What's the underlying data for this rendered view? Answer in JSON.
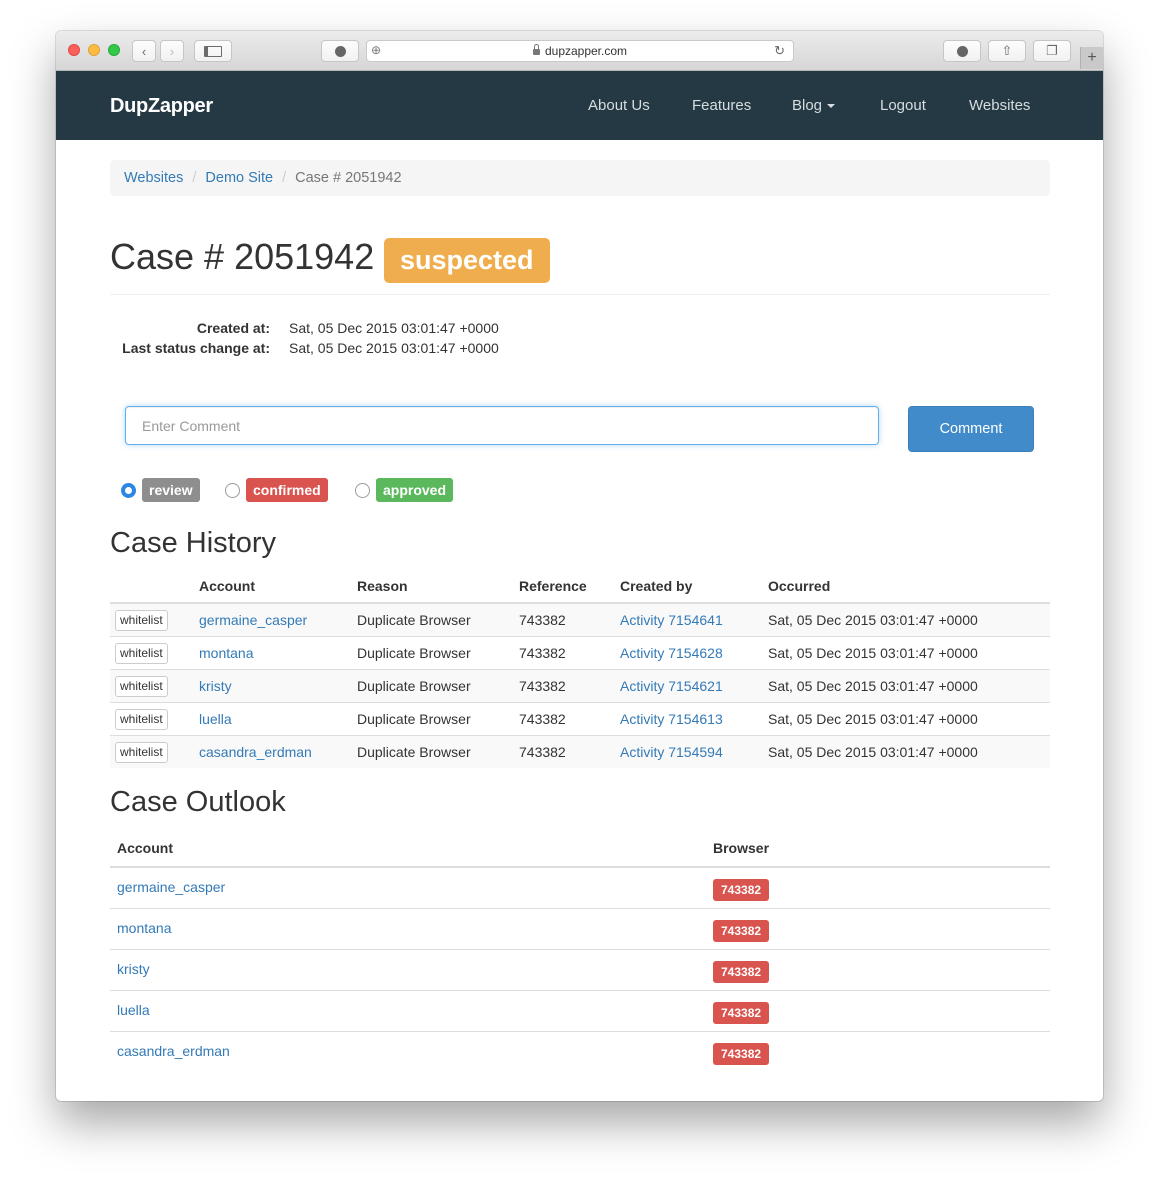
{
  "browser": {
    "url": "dupzapper.com"
  },
  "navbar": {
    "brand": "DupZapper",
    "links": [
      "About Us",
      "Features",
      "Blog",
      "Logout",
      "Websites"
    ]
  },
  "breadcrumb": {
    "items": [
      "Websites",
      "Demo Site"
    ],
    "active": "Case # 2051942"
  },
  "case": {
    "title": "Case # 2051942",
    "status": "suspected",
    "created_label": "Created at:",
    "created_value": "Sat, 05 Dec 2015 03:01:47 +0000",
    "last_change_label": "Last status change at:",
    "last_change_value": "Sat, 05 Dec 2015 03:01:47 +0000"
  },
  "comment": {
    "placeholder": "Enter Comment",
    "button": "Comment"
  },
  "status_options": [
    {
      "label": "review",
      "checked": true
    },
    {
      "label": "confirmed",
      "checked": false
    },
    {
      "label": "approved",
      "checked": false
    }
  ],
  "history": {
    "heading": "Case History",
    "columns": [
      "",
      "Account",
      "Reason",
      "Reference",
      "Created by",
      "Occurred"
    ],
    "action_label": "whitelist",
    "rows": [
      {
        "account": "germaine_casper",
        "reason": "Duplicate Browser",
        "reference": "743382",
        "created_by": "Activity 7154641",
        "occurred": "Sat, 05 Dec 2015 03:01:47 +0000"
      },
      {
        "account": "montana",
        "reason": "Duplicate Browser",
        "reference": "743382",
        "created_by": "Activity 7154628",
        "occurred": "Sat, 05 Dec 2015 03:01:47 +0000"
      },
      {
        "account": "kristy",
        "reason": "Duplicate Browser",
        "reference": "743382",
        "created_by": "Activity 7154621",
        "occurred": "Sat, 05 Dec 2015 03:01:47 +0000"
      },
      {
        "account": "luella",
        "reason": "Duplicate Browser",
        "reference": "743382",
        "created_by": "Activity 7154613",
        "occurred": "Sat, 05 Dec 2015 03:01:47 +0000"
      },
      {
        "account": "casandra_erdman",
        "reason": "Duplicate Browser",
        "reference": "743382",
        "created_by": "Activity 7154594",
        "occurred": "Sat, 05 Dec 2015 03:01:47 +0000"
      }
    ]
  },
  "outlook": {
    "heading": "Case Outlook",
    "columns": [
      "Account",
      "Browser"
    ],
    "rows": [
      {
        "account": "germaine_casper",
        "browser": "743382"
      },
      {
        "account": "montana",
        "browser": "743382"
      },
      {
        "account": "kristy",
        "browser": "743382"
      },
      {
        "account": "luella",
        "browser": "743382"
      },
      {
        "account": "casandra_erdman",
        "browser": "743382"
      }
    ]
  },
  "colors": {
    "navbar_bg": "#243943",
    "link": "#337ab7",
    "suspected": "#f0ad4e",
    "danger": "#d9534f",
    "success": "#5cb85c",
    "primary": "#428bca"
  }
}
